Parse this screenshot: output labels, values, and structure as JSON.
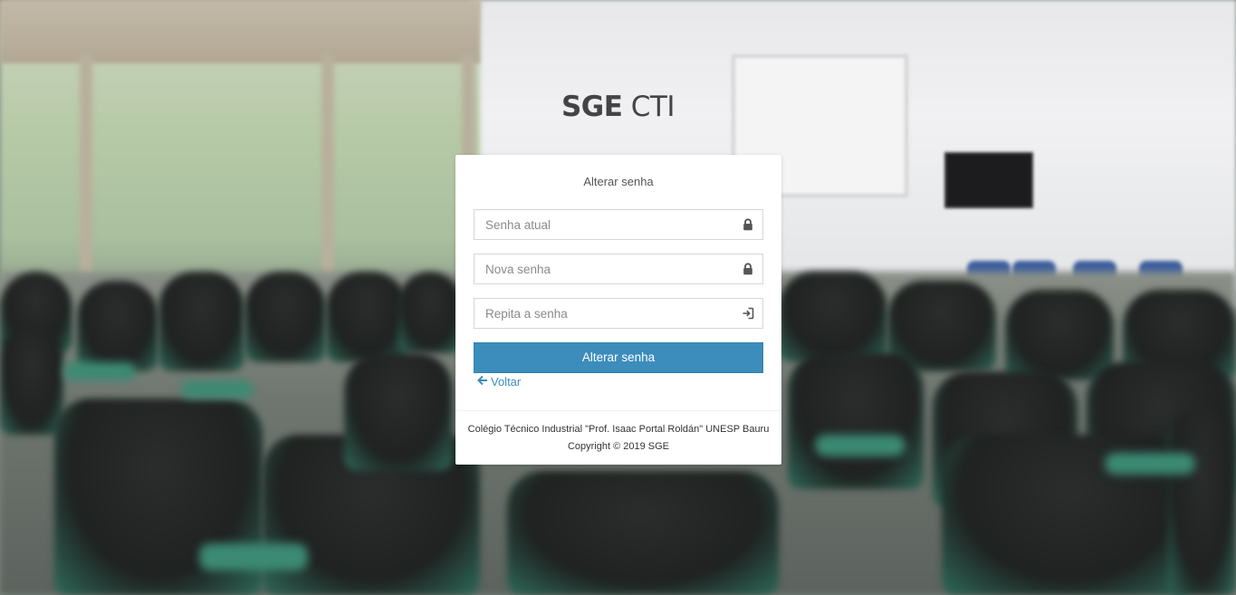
{
  "brand": {
    "bold": "SGE",
    "light": "CTI"
  },
  "form": {
    "title": "Alterar senha",
    "current_password_placeholder": "Senha atual",
    "new_password_placeholder": "Nova senha",
    "repeat_password_placeholder": "Repita a senha",
    "submit_label": "Alterar senha",
    "back_label": "Voltar"
  },
  "footer": {
    "institution": "Colégio Técnico Industrial \"Prof. Isaac Portal Roldán\" UNESP Bauru",
    "copyright": "Copyright © 2019 SGE"
  },
  "icons": {
    "current_password": "lock-icon",
    "new_password": "lock-icon",
    "repeat_password": "sign-in-icon",
    "back": "arrow-left-icon"
  },
  "colors": {
    "primary": "#3c8dbc",
    "text": "#444444"
  }
}
